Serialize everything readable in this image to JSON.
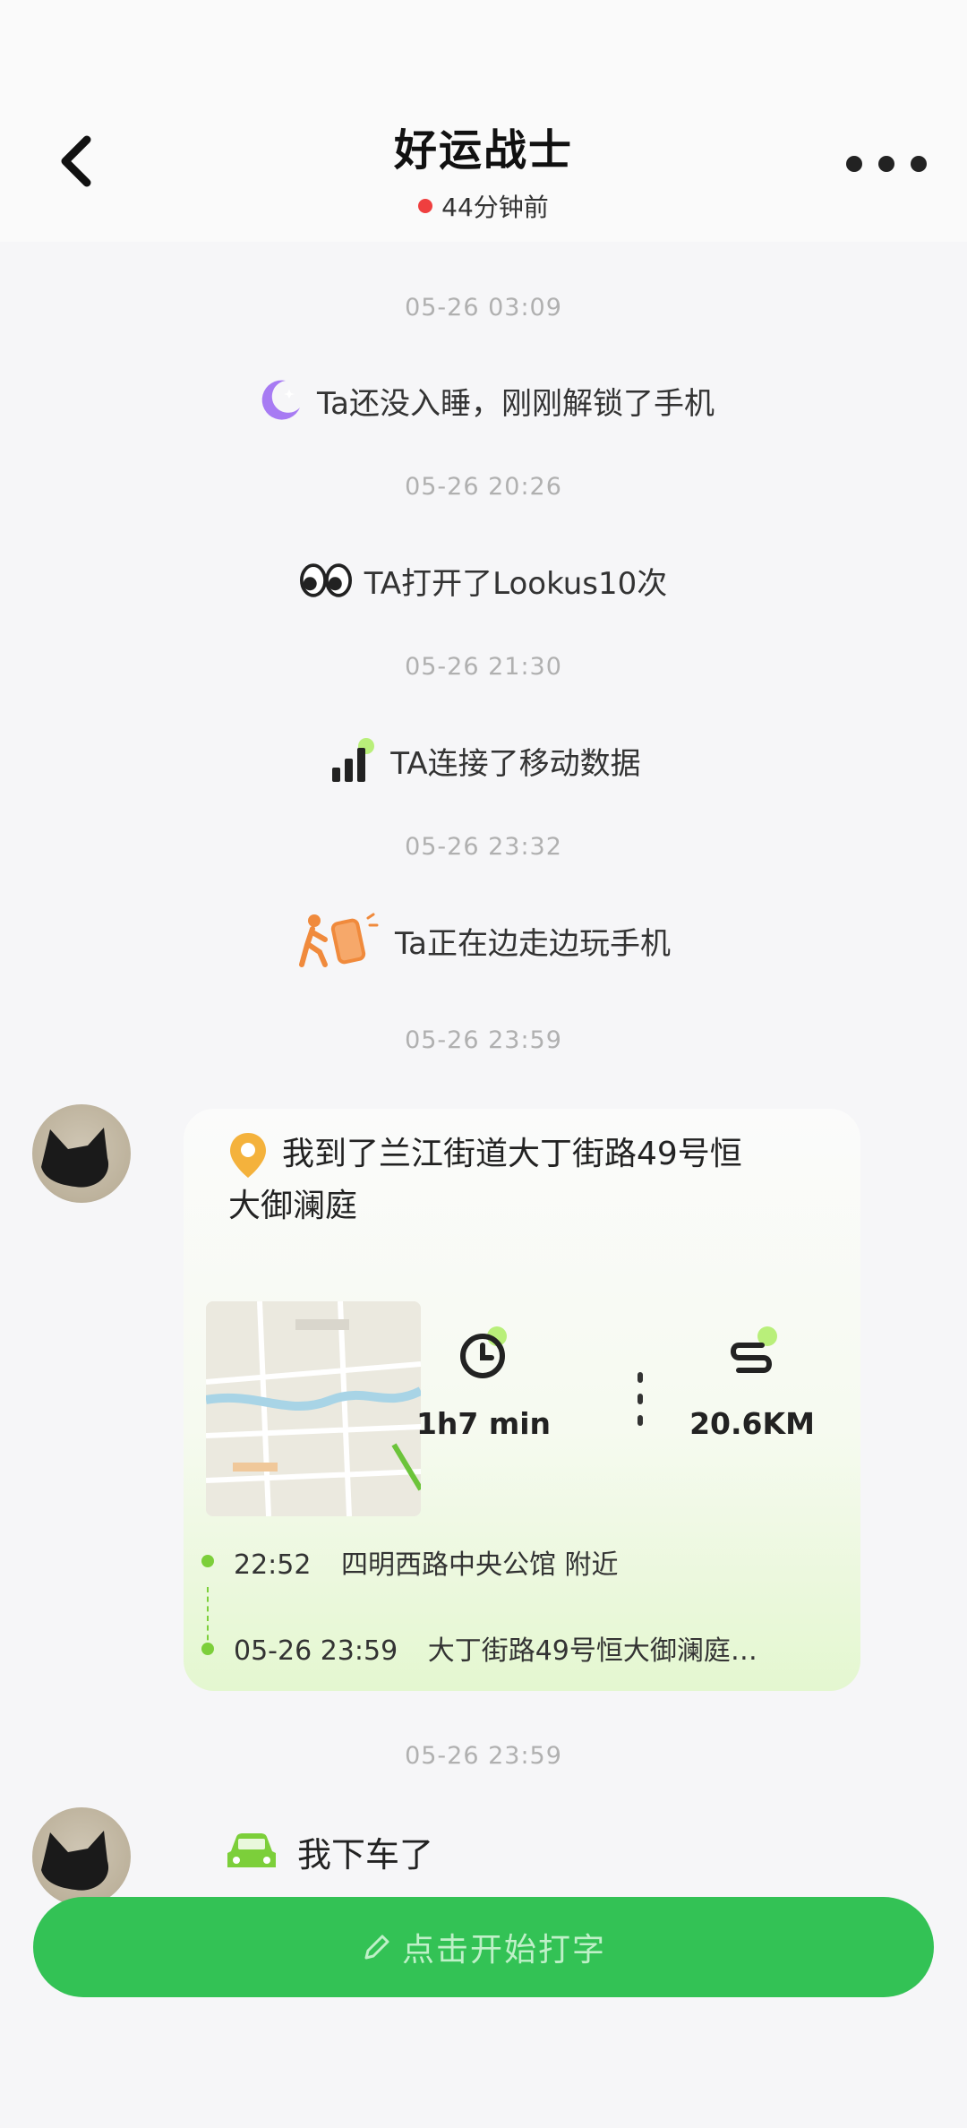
{
  "header": {
    "title": "好运战士",
    "status": "44分钟前",
    "status_color": "#ef3f3f"
  },
  "timeline": [
    {
      "time": "05-26 03:09",
      "icon": "moon-icon",
      "text": "Ta还没入睡，刚刚解锁了手机"
    },
    {
      "time": "05-26 20:26",
      "icon": "eyes-icon",
      "text": "TA打开了Lookus10次"
    },
    {
      "time": "05-26 21:30",
      "icon": "signal-icon",
      "text": "TA连接了移动数据"
    },
    {
      "time": "05-26 23:32",
      "icon": "walking-phone-icon",
      "text": "Ta正在边走边玩手机"
    }
  ],
  "card_time": "05-26 23:59",
  "location_card": {
    "title": "我到了兰江街道大丁街路49号恒大御澜庭",
    "duration": "1h7 min",
    "distance": "20.6KM",
    "route": [
      {
        "time": "22:52",
        "place": "四明西路中央公馆 附近"
      },
      {
        "time": "05-26 23:59",
        "place": "大丁街路49号恒大御澜庭…"
      }
    ]
  },
  "message2_time": "05-26 23:59",
  "message2": {
    "icon": "car-icon",
    "text": "我下车了"
  },
  "input": {
    "placeholder": "点击开始打字"
  },
  "colors": {
    "accent": "#33c255",
    "route": "#7ccf3a",
    "timestamp": "#b0b0b0"
  }
}
